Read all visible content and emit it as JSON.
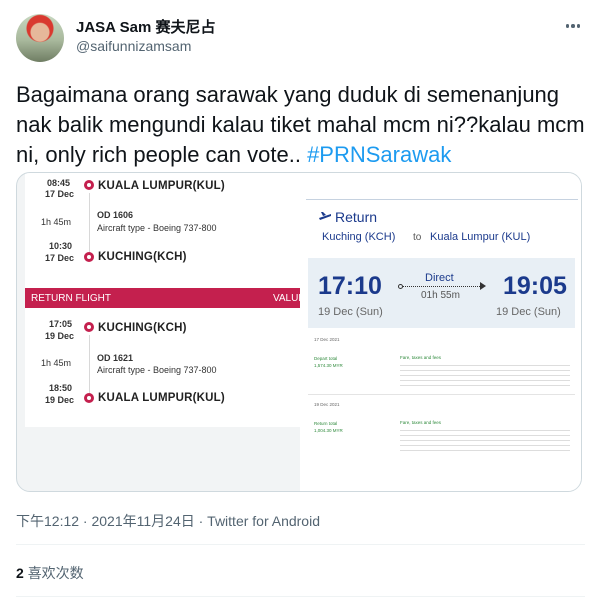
{
  "author": {
    "name": "JASA Sam 赛夫尼占",
    "handle": "@saifunnizamsam"
  },
  "tweet": {
    "text": "Bagaimana orang sarawak yang duduk di semenanjung nak balik mengundi kalau tiket mahal mcm ni??kalau mcm ni, only rich people can vote.. ",
    "hashtag": "#PRNSarawak"
  },
  "media": {
    "left": {
      "outbound": {
        "dep_time": "08:45",
        "dep_date": "17 Dec",
        "dep_place": "KUALA LUMPUR(KUL)",
        "duration": "1h 45m",
        "flight": "OD 1606",
        "aircraft": "Aircraft type - Boeing 737-800",
        "arr_time": "10:30",
        "arr_date": "17 Dec",
        "arr_place": "KUCHING(KCH)"
      },
      "return_label": "RETURN FLIGHT",
      "value_label": "VALUE",
      "inbound": {
        "dep_time": "17:05",
        "dep_date": "19 Dec",
        "dep_place": "KUCHING(KCH)",
        "duration": "1h 45m",
        "flight": "OD 1621",
        "aircraft": "Aircraft type - Boeing 737-800",
        "arr_time": "18:50",
        "arr_date": "19 Dec",
        "arr_place": "KUALA LUMPUR(KUL)"
      }
    },
    "right": {
      "return_label": "Return",
      "route_from": "Kuching (KCH)",
      "route_to_word": "to",
      "route_to": "Kuala Lumpur (KUL)",
      "dep_time": "17:10",
      "arr_time": "19:05",
      "direct": "Direct",
      "duration": "01h 55m",
      "dep_date": "19 Dec (Sun)",
      "arr_date": "19 Dec (Sun)",
      "depart_date_small": "17 Dec 2021",
      "depart_total_label": "Depart total",
      "depart_total": "1,574.30 MYR",
      "return_date_small": "19 Dec 2021",
      "return_total_label": "Return total",
      "return_total": "1,004.30 MYR",
      "fare_label": "Fare, taxes and fees"
    }
  },
  "meta": {
    "timestamp": "下午12:12 · 2021年11月24日 · Twitter for Android"
  },
  "stats": {
    "likes_count": "2",
    "likes_label": "喜欢次数"
  },
  "colors": {
    "accent": "#1d9bf0",
    "airline_red": "#c4204e",
    "airline_blue": "#1b3a8c"
  }
}
